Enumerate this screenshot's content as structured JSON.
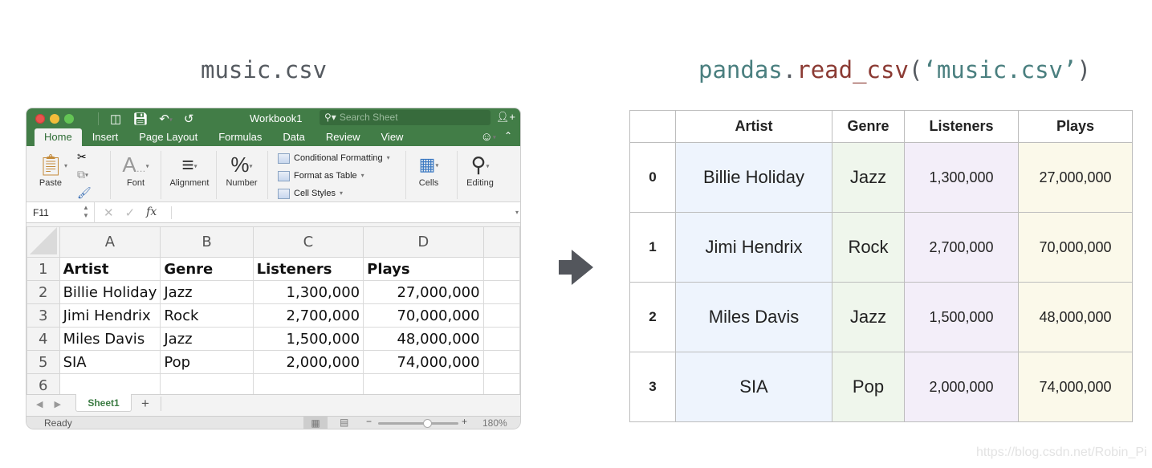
{
  "captions": {
    "left": "music.csv",
    "right_module": "pandas",
    "right_dot": ".",
    "right_func": "read_csv",
    "right_open": "(",
    "right_arg": "‘music.csv’",
    "right_close": ")"
  },
  "excel": {
    "window_title": "Workbook1",
    "search_placeholder": "Search Sheet",
    "tabs": [
      "Home",
      "Insert",
      "Page Layout",
      "Formulas",
      "Data",
      "Review",
      "View"
    ],
    "active_tab": "Home",
    "ribbon": {
      "paste": "Paste",
      "font": "Font",
      "alignment": "Alignment",
      "number": "Number",
      "conditional_formatting": "Conditional Formatting",
      "format_as_table": "Format as Table",
      "cell_styles": "Cell Styles",
      "cells": "Cells",
      "editing": "Editing"
    },
    "name_box": "F11",
    "formula_value": "",
    "fx_label": "fx",
    "column_headers": [
      "A",
      "B",
      "C",
      "D"
    ],
    "row_numbers": [
      "1",
      "2",
      "3",
      "4",
      "5",
      "6"
    ],
    "rows": [
      [
        "Artist",
        "Genre",
        "Listeners",
        "Plays"
      ],
      [
        "Billie Holiday",
        "Jazz",
        "1,300,000",
        "27,000,000"
      ],
      [
        "Jimi Hendrix",
        "Rock",
        "2,700,000",
        "70,000,000"
      ],
      [
        "Miles Davis",
        "Jazz",
        "1,500,000",
        "48,000,000"
      ],
      [
        "SIA",
        "Pop",
        "2,000,000",
        "74,000,000"
      ],
      [
        "",
        "",
        "",
        ""
      ]
    ],
    "sheet_tab": "Sheet1",
    "add_sheet": "+",
    "status": "Ready",
    "zoom_level": "180%",
    "zoom_fraction": 0.62
  },
  "dataframe": {
    "columns": [
      "Artist",
      "Genre",
      "Listeners",
      "Plays"
    ],
    "index": [
      "0",
      "1",
      "2",
      "3"
    ],
    "rows": [
      [
        "Billie Holiday",
        "Jazz",
        "1,300,000",
        "27,000,000"
      ],
      [
        "Jimi Hendrix",
        "Rock",
        "2,700,000",
        "70,000,000"
      ],
      [
        "Miles Davis",
        "Jazz",
        "1,500,000",
        "48,000,000"
      ],
      [
        "SIA",
        "Pop",
        "2,000,000",
        "74,000,000"
      ]
    ]
  },
  "watermark": "https://blog.csdn.net/Robin_Pi"
}
